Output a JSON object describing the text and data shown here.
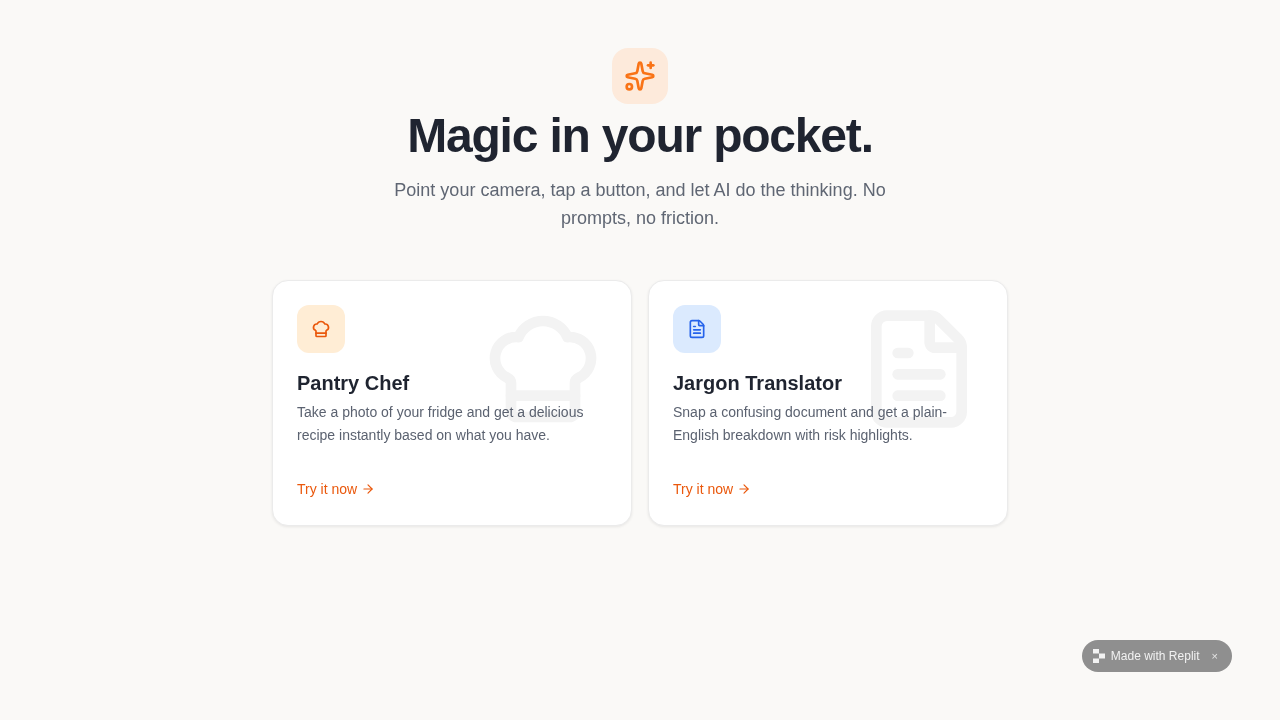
{
  "hero": {
    "title": "Magic in your pocket.",
    "subtitle": "Point your camera, tap a button, and let AI do the thinking. No prompts, no friction."
  },
  "cards": [
    {
      "kind": "chef",
      "title": "Pantry Chef",
      "description": "Take a photo of your fridge and get a delicious recipe instantly based on what you have.",
      "link": "Try it now"
    },
    {
      "kind": "document",
      "title": "Jargon Translator",
      "description": "Snap a confusing document and get a plain-English breakdown with risk highlights.",
      "link": "Try it now"
    }
  ],
  "badge": {
    "label": "Made with Replit",
    "close": "×"
  }
}
